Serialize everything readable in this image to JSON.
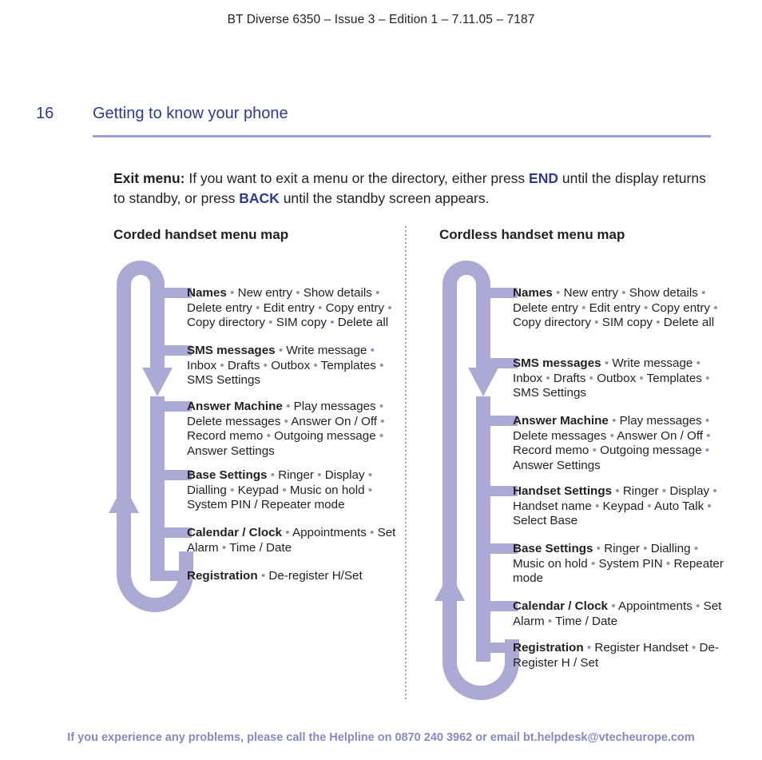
{
  "running_head": "BT Diverse 6350 – Issue 3 – Edition 1 – 7.11.05 – 7187",
  "page": {
    "folio": "16",
    "chapter": "Getting to know your phone"
  },
  "intro": {
    "lead": "Exit menu:",
    "text_1": " If you want to exit a menu or the directory, either press ",
    "key_1": "END",
    "text_2": " until the display returns to standby, or press ",
    "key_2": "BACK",
    "text_3": " until the standby screen appears."
  },
  "columns": {
    "left": {
      "title": "Corded handset menu map",
      "entries": [
        {
          "name": "Names",
          "items": "• New entry • Show details • Delete entry • Edit entry • Copy entry • Copy directory • SIM copy • Delete all"
        },
        {
          "name": "SMS messages",
          "items": "• Write message • Inbox • Drafts • Outbox • Templates • SMS Settings"
        },
        {
          "name": "Answer Machine",
          "items": "• Play messages • Delete messages • Answer On / Off • Record memo • Outgoing message • Answer Settings"
        },
        {
          "name": "Base Settings",
          "items": "• Ringer • Display • Dialling • Keypad • Music on hold • System PIN / Repeater mode"
        },
        {
          "name": "Calendar / Clock",
          "items": "• Appointments • Set Alarm • Time / Date"
        },
        {
          "name": "Registration",
          "items": "• De-register H/Set"
        }
      ]
    },
    "right": {
      "title": "Cordless handset menu map",
      "entries": [
        {
          "name": "Names",
          "items": "• New entry • Show details • Delete entry • Edit entry • Copy entry • Copy directory • SIM copy • Delete all"
        },
        {
          "name": "SMS messages",
          "items": "• Write message • Inbox • Drafts • Outbox • Templates • SMS Settings"
        },
        {
          "name": "Answer Machine",
          "items": "• Play messages • Delete messages • Answer On / Off • Record memo • Outgoing message • Answer Settings"
        },
        {
          "name": "Handset Settings",
          "items": "• Ringer • Display • Handset name • Keypad • Auto Talk • Select Base"
        },
        {
          "name": "Base Settings",
          "items": "• Ringer • Dialling • Music on hold • System PIN • Repeater mode"
        },
        {
          "name": "Calendar / Clock",
          "items": "• Appointments • Set Alarm • Time / Date"
        },
        {
          "name": "Registration",
          "items": "• Register Handset • De-Register H / Set"
        }
      ]
    }
  },
  "footer": {
    "text_1": "If you experience any problems, please call the Helpline on ",
    "phone": "0870 240 3962",
    "text_2": " or email ",
    "email": "bt.helpdesk@vtecheurope.com"
  },
  "colors": {
    "purple": "#aaaad5",
    "purple_dark": "#8888c4",
    "heading_blue": "#2c3b8f",
    "body": "#231f20"
  },
  "layout": {
    "left_entry_tops": [
      38,
      110,
      180,
      266,
      338,
      392
    ],
    "right_entry_tops": [
      38,
      126,
      198,
      286,
      358,
      430,
      482
    ]
  }
}
